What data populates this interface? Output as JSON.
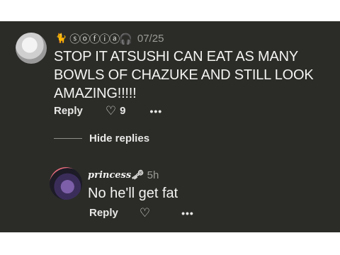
{
  "comment": {
    "author_icon": "cat-icon",
    "author_handle": "ⓢⓞⓕⓘⓐ🎧",
    "date": "07/25",
    "text": "STOP IT ATSUSHI CAN EAT AS MANY BOWLS OF CHAZUKE AND STILL LOOK AMAZING!!!!!",
    "reply_label": "Reply",
    "like_count": "9",
    "more_glyph": "•••"
  },
  "replies_toggle": {
    "label": "Hide replies"
  },
  "reply": {
    "author": "princess🗝",
    "time": "5h",
    "text": "No he'll get fat",
    "reply_label": "Reply",
    "more_glyph": "•••"
  },
  "colors": {
    "panel_bg": "#2b2c28",
    "text": "#f4f4f2",
    "muted": "#9b9b96"
  }
}
